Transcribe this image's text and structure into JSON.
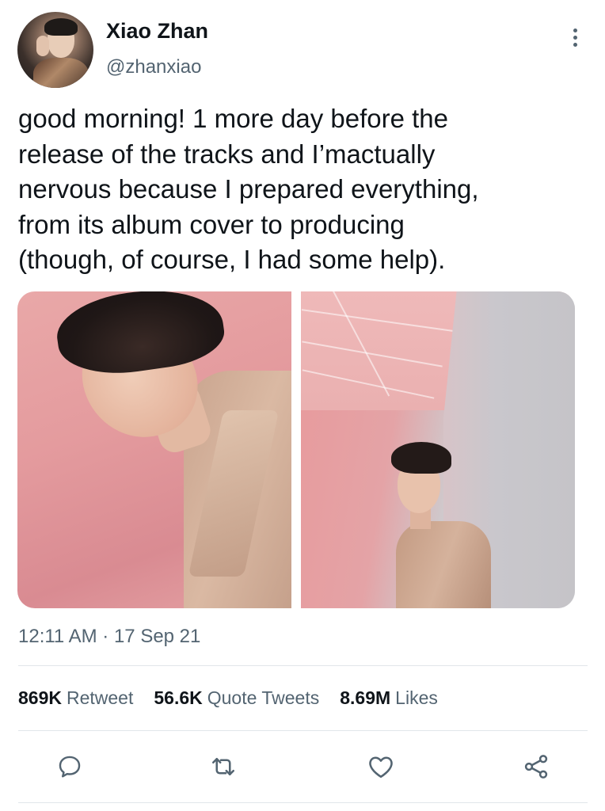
{
  "author": {
    "display_name": "Xiao Zhan",
    "handle": "@zhanxiao"
  },
  "tweet": {
    "text": "good morning! 1 more day before the\nrelease of the tracks and I’mactually\nnervous because I prepared everything,\nfrom its album cover to producing\n(though, of course, I had some help).",
    "timestamp": "12:11 AM · 17 Sep 21"
  },
  "media": {
    "count": 2
  },
  "stats": {
    "retweets_count": "869K",
    "retweets_label": "Retweet",
    "quotes_count": "56.6K",
    "quotes_label": "Quote Tweets",
    "likes_count": "8.69M",
    "likes_label": "Likes"
  },
  "actions": {
    "icons": [
      "reply-icon",
      "retweet-icon",
      "like-icon",
      "share-icon"
    ]
  },
  "colors": {
    "text_primary": "#0f1419",
    "text_secondary": "#536471",
    "divider": "#e1e6ea"
  }
}
